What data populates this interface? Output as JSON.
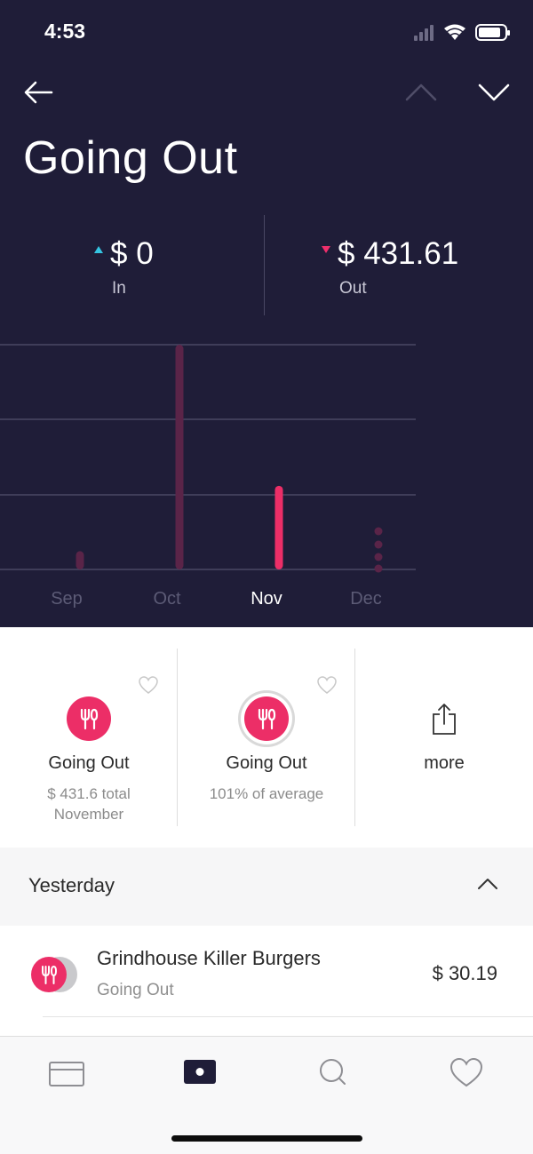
{
  "status_bar": {
    "time": "4:53"
  },
  "header": {
    "title": "Going Out"
  },
  "summary": {
    "in": {
      "amount": "$ 0",
      "label": "In"
    },
    "out": {
      "amount": "$ 431.61",
      "label": "Out"
    }
  },
  "colors": {
    "background": "#1f1d38",
    "accent": "#ec2e67",
    "in_indicator": "#35c5e2"
  },
  "chart_data": {
    "type": "bar",
    "categories": [
      "Sep",
      "Oct",
      "Nov",
      "Dec"
    ],
    "values": [
      70,
      860,
      320,
      0
    ],
    "selected": "Nov",
    "title": "",
    "xlabel": "",
    "ylabel": ""
  },
  "cards": [
    {
      "icon": "utensils-icon",
      "title": "Going Out",
      "subtitle": "$ 431.6 total November"
    },
    {
      "icon": "utensils-icon",
      "title": "Going Out",
      "subtitle": "101% of average"
    },
    {
      "icon": "share-icon",
      "title": "more"
    }
  ],
  "section": {
    "title": "Yesterday"
  },
  "transactions": [
    {
      "merchant": "Grindhouse Killer Burgers",
      "category": "Going Out",
      "amount": "$ 30.19"
    }
  ],
  "tabs": [
    {
      "name": "tab-cards",
      "icon": "card-icon"
    },
    {
      "name": "tab-wallet",
      "icon": "wallet-icon",
      "active": true
    },
    {
      "name": "tab-search",
      "icon": "search-icon"
    },
    {
      "name": "tab-favorites",
      "icon": "heart-icon"
    }
  ]
}
